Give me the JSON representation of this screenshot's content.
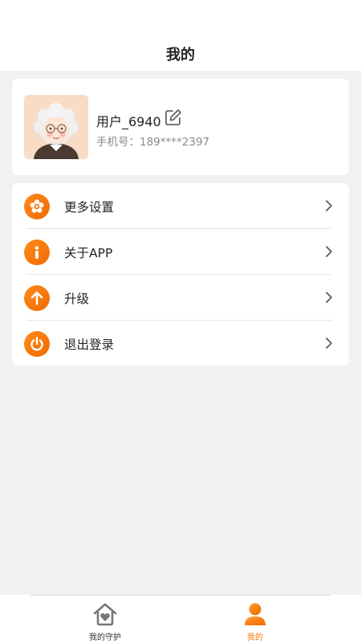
{
  "header": {
    "title": "我的"
  },
  "profile": {
    "username": "用户_6940",
    "phone": "手机号：189****2397"
  },
  "menu": {
    "items": [
      {
        "label": "更多设置",
        "icon": "settings-flower-icon"
      },
      {
        "label": "关于APP",
        "icon": "info-icon"
      },
      {
        "label": "升级",
        "icon": "arrow-up-icon"
      },
      {
        "label": "退出登录",
        "icon": "power-icon"
      }
    ]
  },
  "tabbar": {
    "tabs": [
      {
        "label": "我的守护",
        "icon": "house-heart-icon",
        "active": false
      },
      {
        "label": "我的",
        "icon": "person-icon",
        "active": true
      }
    ]
  },
  "colors": {
    "accent": "#f07c00",
    "background": "#f1f1f1",
    "card": "#ffffff"
  }
}
